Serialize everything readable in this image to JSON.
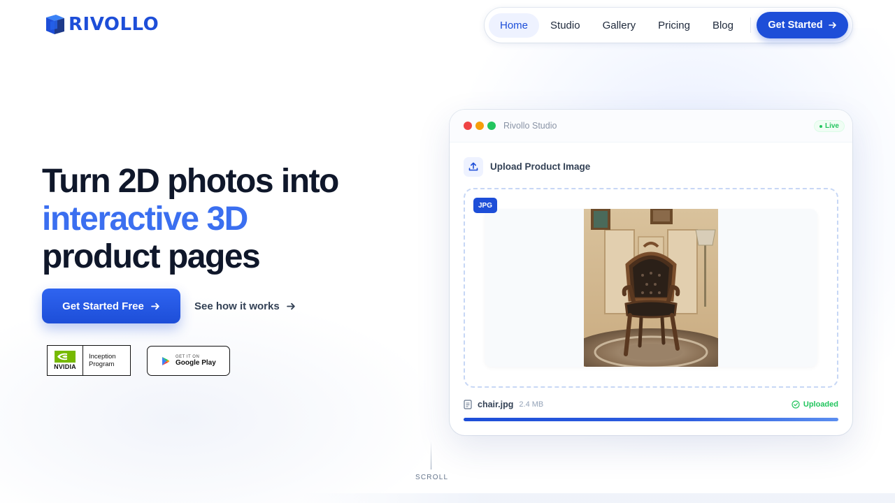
{
  "brand": {
    "name": "RIVOLLO",
    "color": "#1d4ed8"
  },
  "nav": {
    "items": [
      {
        "label": "Home",
        "active": true
      },
      {
        "label": "Studio",
        "active": false
      },
      {
        "label": "Gallery",
        "active": false
      },
      {
        "label": "Pricing",
        "active": false
      },
      {
        "label": "Blog",
        "active": false
      }
    ],
    "cta_label": "Get Started",
    "cta_icon": "arrow-right-icon"
  },
  "hero": {
    "title_line1": "Turn 2D photos into",
    "title_line2": "interactive 3D",
    "title_line3": "product pages",
    "accent_color": "#3b6ff0",
    "primary_cta": "Get Started Free",
    "secondary_cta": "See how it works"
  },
  "badges": {
    "nvidia": {
      "word": "NVIDIA",
      "line1": "Inception",
      "line2": "Program"
    },
    "google_play": {
      "small": "GET IT ON",
      "big": "Google Play"
    }
  },
  "studio": {
    "title": "Rivollo Studio",
    "status": "Live",
    "upload_label": "Upload Product Image",
    "file_type_tag": "JPG",
    "file_name": "chair.jpg",
    "file_size": "2.4 MB",
    "upload_status": "Uploaded",
    "progress_percent": 100,
    "window_dots": [
      "#ef4444",
      "#f59e0b",
      "#22c55e"
    ]
  },
  "scroll_label": "SCROLL"
}
